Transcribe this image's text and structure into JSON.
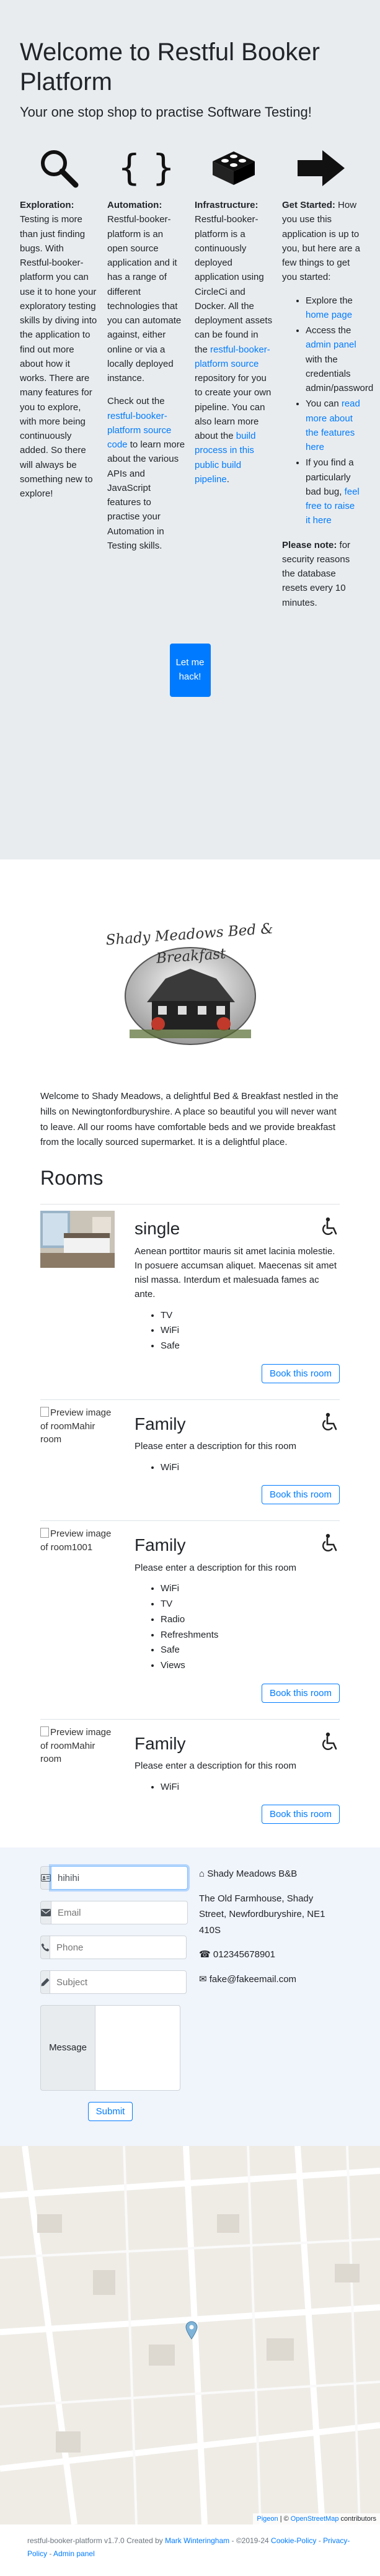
{
  "hero": {
    "title": "Welcome to Restful Booker Platform",
    "subtitle": "Your one stop shop to practise Software Testing!",
    "columns": [
      {
        "icon": "search-icon",
        "heading": "Exploration:",
        "text": "Testing is more than just finding bugs. With Restful-booker-platform you can use it to hone your exploratory testing skills by diving into the application to find out more about how it works. There are many features for you to explore, with more being continuously added. So there will always be something new to explore!"
      },
      {
        "icon": "braces-icon",
        "heading": "Automation:",
        "text": "Restful-booker-platform is an open source application and it has a range of different technologies that you can automate against, either online or via a locally deployed instance.",
        "text2_before": "Check out the",
        "link": "restful-booker-platform source code",
        "text2_after": "to learn more about the various APIs and JavaScript features to practise your Automation in Testing skills."
      },
      {
        "icon": "bricks-icon",
        "heading": "Infrastructure:",
        "text_before": "Restful-booker-platform is a continuously deployed application using CircleCi and Docker. All the deployment assets can be found in the",
        "link": "restful-booker-platform source",
        "text_mid": "repository for you to create your own pipeline. You can also learn more about the",
        "link2": "build process in this public build pipeline",
        "text_after": "."
      },
      {
        "icon": "arrow-right-icon",
        "heading": "Get Started:",
        "text": "How you use this application is up to you, but here are a few things to get you started:",
        "items": [
          {
            "before": "Explore the",
            "link": "home page",
            "after": ""
          },
          {
            "before": "Access the",
            "link": "admin panel",
            "after": "with the credentials admin/password"
          },
          {
            "before": "You can",
            "link": "read more about the features here",
            "after": ""
          },
          {
            "before": "If you find a particularly bad bug,",
            "link": "feel free to raise it here",
            "after": ""
          }
        ],
        "note_heading": "Please note:",
        "note": "for security reasons the database resets every 10 minutes."
      }
    ],
    "cta": "Let me hack!"
  },
  "branding": {
    "logo_text": "Shady Meadows Bed & Breakfast",
    "intro": "Welcome to Shady Meadows, a delightful Bed & Breakfast nestled in the hills on Newingtonfordburyshire. A place so beautiful you will never want to leave. All our rooms have comfortable beds and we provide breakfast from the locally sourced supermarket. It is a delightful place."
  },
  "rooms_title": "Rooms",
  "rooms": [
    {
      "name": "single",
      "image_alt": "",
      "has_image": true,
      "description": "Aenean porttitor mauris sit amet lacinia molestie. In posuere accumsan aliquet. Maecenas sit amet nisl massa. Interdum et malesuada fames ac ante.",
      "features": [
        "TV",
        "WiFi",
        "Safe"
      ],
      "button": "Book this room"
    },
    {
      "name": "Family",
      "image_alt": "Preview image of roomMahir room",
      "has_image": false,
      "description": "Please enter a description for this room",
      "features": [
        "WiFi"
      ],
      "button": "Book this room"
    },
    {
      "name": "Family",
      "image_alt": "Preview image of room1001",
      "has_image": false,
      "description": "Please enter a description for this room",
      "features": [
        "WiFi",
        "TV",
        "Radio",
        "Refreshments",
        "Safe",
        "Views"
      ],
      "button": "Book this room"
    },
    {
      "name": "Family",
      "image_alt": "Preview image of roomMahir room",
      "has_image": false,
      "description": "Please enter a description for this room",
      "features": [
        "WiFi"
      ],
      "button": "Book this room"
    }
  ],
  "contact": {
    "name_value": "hihihi",
    "email_placeholder": "Email",
    "phone_placeholder": "Phone",
    "subject_placeholder": "Subject",
    "message_label": "Message",
    "submit": "Submit",
    "business_name": "Shady Meadows B&B",
    "address": "The Old Farmhouse, Shady Street, Newfordburyshire, NE1 410S",
    "phone": "012345678901",
    "email": "fake@fakeemail.com"
  },
  "map": {
    "attribution_link1": "Pigeon",
    "attribution_sep": "| ©",
    "attribution_link2": "OpenStreetMap",
    "attribution_after": "contributors"
  },
  "footer": {
    "text": "restful-booker-platform v1.7.0 Created by",
    "author": "Mark Winteringham",
    "mid": "- ©2019-24",
    "cookie": "Cookie-Policy",
    "dash": "-",
    "privacy": "Privacy-Policy",
    "admin": "Admin panel"
  },
  "colors": {
    "accent": "#007bff",
    "hero_bg": "#e9ecef",
    "contact_bg": "#f0f4fb"
  }
}
